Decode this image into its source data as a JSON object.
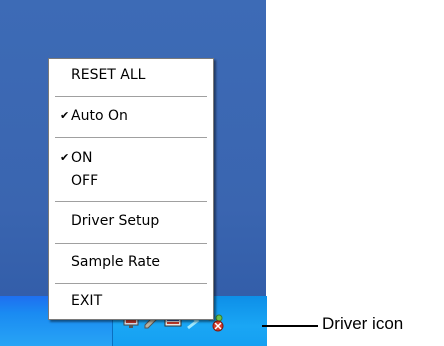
{
  "context_menu": {
    "items": {
      "reset_all": "RESET ALL",
      "auto_on": "Auto On",
      "on": "ON",
      "off": "OFF",
      "driver_setup": "Driver Setup",
      "sample_rate": "Sample Rate",
      "exit": "EXIT"
    },
    "checked": [
      "auto_on",
      "on"
    ],
    "check_glyph": "✔"
  },
  "callout": {
    "label": "Driver icon"
  },
  "taskbar": {
    "tray_icons": [
      "monitor-icon",
      "pencil-icon",
      "speaker-icon",
      "arrow-icon",
      "driver-icon"
    ]
  },
  "colors": {
    "desktop": "#3a65b0",
    "taskbar": "#1a8bf2",
    "menu_background": "#ffffff"
  }
}
